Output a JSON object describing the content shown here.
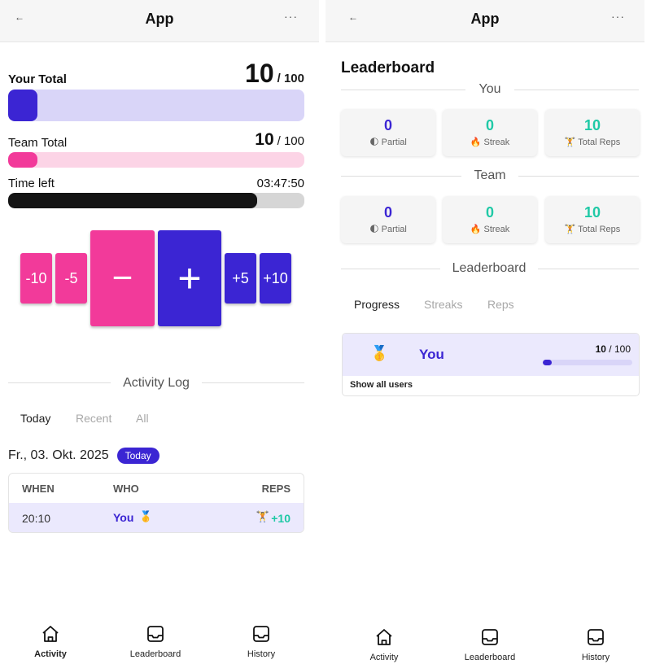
{
  "colors": {
    "accent_blue": "#3b25d3",
    "accent_pink": "#f23a9a",
    "teal": "#1fc9a6",
    "track_lavender": "#d9d5f8",
    "track_pink": "#fcd4e6",
    "track_gray": "#d6d6d6",
    "time_fill": "#141414"
  },
  "left": {
    "header": {
      "back_icon": "←",
      "title": "App",
      "more_icon": "···"
    },
    "your_total": {
      "label": "Your Total",
      "value": "10",
      "max": "/ 100",
      "progress": 0.1
    },
    "team_total": {
      "label": "Team Total",
      "value": "10",
      "max": "/ 100",
      "progress": 0.1
    },
    "time_left": {
      "label": "Time left",
      "value": "03:47:50",
      "progress": 0.84
    },
    "buttons": {
      "minus10": "-10",
      "minus5": "-5",
      "minus": "−",
      "plus": "+",
      "plus5": "+5",
      "plus10": "+10"
    },
    "activity_log": {
      "title": "Activity Log",
      "tabs": [
        "Today",
        "Recent",
        "All"
      ],
      "date": "Fr., 03. Okt. 2025",
      "date_badge": "Today",
      "columns": [
        "WHEN",
        "WHO",
        "REPS"
      ],
      "rows": [
        {
          "when": "20:10",
          "who": "You",
          "who_icon": "🥇",
          "reps_icon": "🏋",
          "reps": "+10"
        }
      ]
    },
    "nav": [
      {
        "label": "Activity",
        "icon": "home-icon"
      },
      {
        "label": "Leaderboard",
        "icon": "inbox-icon"
      },
      {
        "label": "History",
        "icon": "inbox-icon"
      }
    ]
  },
  "right": {
    "header": {
      "back_icon": "←",
      "title": "App",
      "more_icon": "···"
    },
    "page_title": "Leaderboard",
    "you_title": "You",
    "team_title": "Team",
    "you_stats": [
      {
        "value": "0",
        "icon": "🌓",
        "label": "Partial"
      },
      {
        "value": "0",
        "icon": "🔥",
        "label": "Streak"
      },
      {
        "value": "10",
        "icon": "🏋",
        "label": "Total Reps"
      }
    ],
    "team_stats": [
      {
        "value": "0",
        "icon": "🌓",
        "label": "Partial"
      },
      {
        "value": "0",
        "icon": "🔥",
        "label": "Streak"
      },
      {
        "value": "10",
        "icon": "🏋",
        "label": "Total Reps"
      }
    ],
    "leaderboard_title": "Leaderboard",
    "tabs": [
      "Progress",
      "Streaks",
      "Reps"
    ],
    "entry": {
      "medal": "🥇",
      "name": "You",
      "value": "10",
      "max": "/ 100",
      "progress": 0.1
    },
    "show_all": "Show all users",
    "nav": [
      {
        "label": "Activity",
        "icon": "home-icon"
      },
      {
        "label": "Leaderboard",
        "icon": "inbox-icon"
      },
      {
        "label": "History",
        "icon": "inbox-icon"
      }
    ]
  }
}
